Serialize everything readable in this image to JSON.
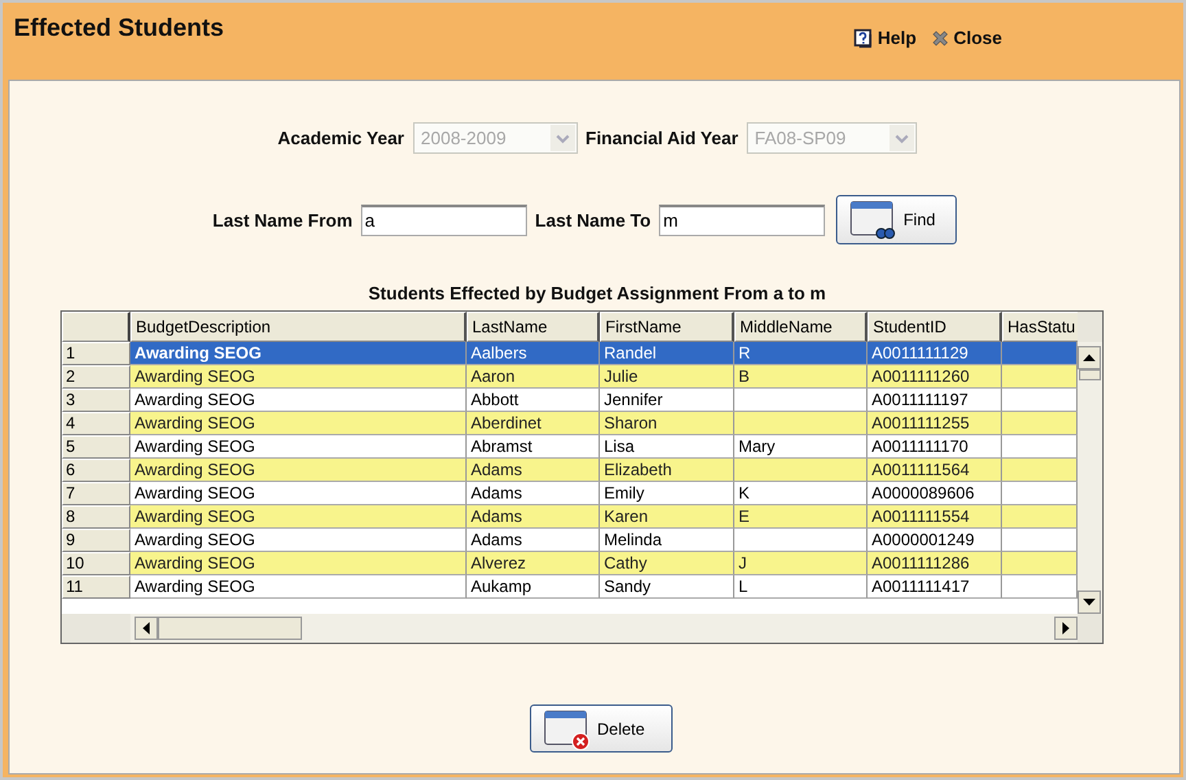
{
  "window": {
    "title": "Effected Students"
  },
  "header_links": [
    {
      "label": "Help",
      "kind": "help"
    },
    {
      "label": "Close",
      "kind": "close"
    }
  ],
  "year_filters": [
    {
      "label": "Academic Year",
      "value": "2008-2009",
      "disabled": true
    },
    {
      "label": "Financial Aid Year",
      "value": "FA08-SP09",
      "disabled": true
    }
  ],
  "name_range": [
    {
      "label": "Last Name From",
      "value": "a"
    },
    {
      "label": "Last Name To",
      "value": "m"
    }
  ],
  "find_button": {
    "label": "Find"
  },
  "table": {
    "title": "Students Effected by Budget Assignment From a to m",
    "columns": [
      "BudgetDescription",
      "LastName",
      "FirstName",
      "MiddleName",
      "StudentID",
      "HasStatu"
    ],
    "rows": [
      {
        "number": "1",
        "selected": true,
        "cells": [
          "Awarding SEOG",
          "Aalbers",
          "Randel",
          "R",
          "A0011111129",
          ""
        ]
      },
      {
        "number": "2",
        "selected": false,
        "cells": [
          "Awarding SEOG",
          "Aaron",
          "Julie",
          "B",
          "A0011111260",
          ""
        ]
      },
      {
        "number": "3",
        "selected": false,
        "cells": [
          "Awarding SEOG",
          "Abbott",
          "Jennifer",
          "",
          "A0011111197",
          ""
        ]
      },
      {
        "number": "4",
        "selected": false,
        "cells": [
          "Awarding SEOG",
          "Aberdinet",
          "Sharon",
          "",
          "A0011111255",
          ""
        ]
      },
      {
        "number": "5",
        "selected": false,
        "cells": [
          "Awarding SEOG",
          "Abramst",
          "Lisa",
          "Mary",
          "A0011111170",
          ""
        ]
      },
      {
        "number": "6",
        "selected": false,
        "cells": [
          "Awarding SEOG",
          "Adams",
          "Elizabeth",
          "",
          "A0011111564",
          ""
        ]
      },
      {
        "number": "7",
        "selected": false,
        "cells": [
          "Awarding SEOG",
          "Adams",
          "Emily",
          "K",
          "A0000089606",
          ""
        ]
      },
      {
        "number": "8",
        "selected": false,
        "cells": [
          "Awarding SEOG",
          "Adams",
          "Karen",
          "E",
          "A0011111554",
          ""
        ]
      },
      {
        "number": "9",
        "selected": false,
        "cells": [
          "Awarding SEOG",
          "Adams",
          "Melinda",
          "",
          "A0000001249",
          ""
        ]
      },
      {
        "number": "10",
        "selected": false,
        "cells": [
          "Awarding SEOG",
          "Alverez",
          "Cathy",
          "J",
          "A0011111286",
          ""
        ]
      },
      {
        "number": "11",
        "selected": false,
        "cells": [
          "Awarding SEOG",
          "Aukamp",
          "Sandy",
          "L",
          "A0011111417",
          ""
        ]
      }
    ]
  },
  "buttons": [
    {
      "label": "Delete",
      "kind": "delete"
    }
  ]
}
